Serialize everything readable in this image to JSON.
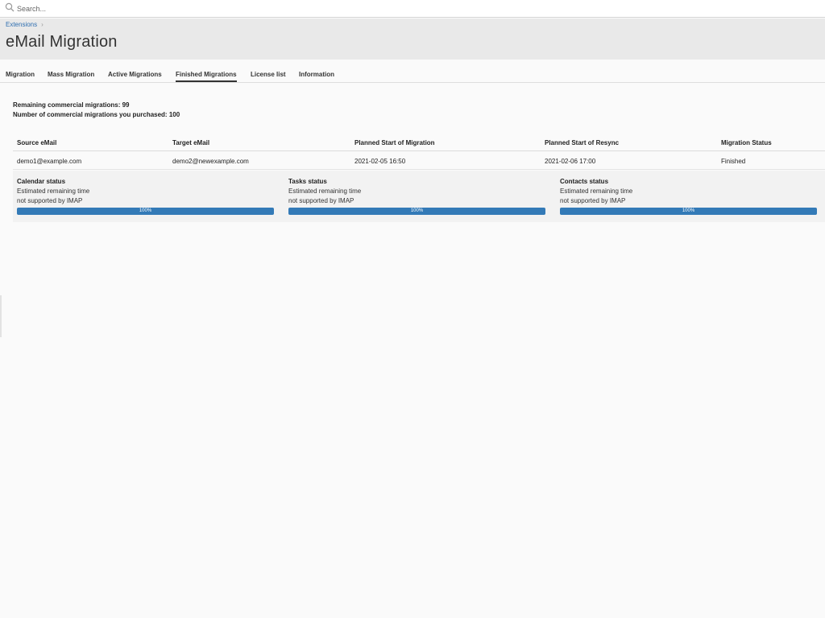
{
  "search": {
    "placeholder": "Search..."
  },
  "breadcrumb": {
    "items": [
      {
        "label": "Extensions"
      }
    ]
  },
  "page": {
    "title": "eMail Migration"
  },
  "tabs": [
    {
      "label": "Migration",
      "active": false
    },
    {
      "label": "Mass Migration",
      "active": false
    },
    {
      "label": "Active Migrations",
      "active": false
    },
    {
      "label": "Finished Migrations",
      "active": true
    },
    {
      "label": "License list",
      "active": false
    },
    {
      "label": "Information",
      "active": false
    }
  ],
  "summary": {
    "remaining": "Remaining commercial migrations: 99",
    "purchased": "Number of commercial migrations you purchased: 100"
  },
  "table": {
    "columns": [
      "Source eMail",
      "Target eMail",
      "Planned Start of Migration",
      "Planned Start of Resync",
      "Migration Status"
    ],
    "rows": [
      {
        "source": "demo1@example.com",
        "target": "demo2@newexample.com",
        "planned_start": "2021-02-05 16:50",
        "planned_resync": "2021-02-06 17:00",
        "status": "Finished"
      }
    ]
  },
  "details": [
    {
      "title": "Calendar status",
      "line1": "Estimated remaining time",
      "line2": "not supported by IMAP",
      "progress": 100,
      "progress_label": "100%"
    },
    {
      "title": "Tasks status",
      "line1": "Estimated remaining time",
      "line2": "not supported by IMAP",
      "progress": 100,
      "progress_label": "100%"
    },
    {
      "title": "Contacts status",
      "line1": "Estimated remaining time",
      "line2": "not supported by IMAP",
      "progress": 100,
      "progress_label": "100%"
    }
  ],
  "icons": {
    "search": "search-icon",
    "breadcrumb_separator": "chevron-right-icon"
  },
  "colors": {
    "link": "#2f6fb0",
    "progress": "#337ab7"
  }
}
